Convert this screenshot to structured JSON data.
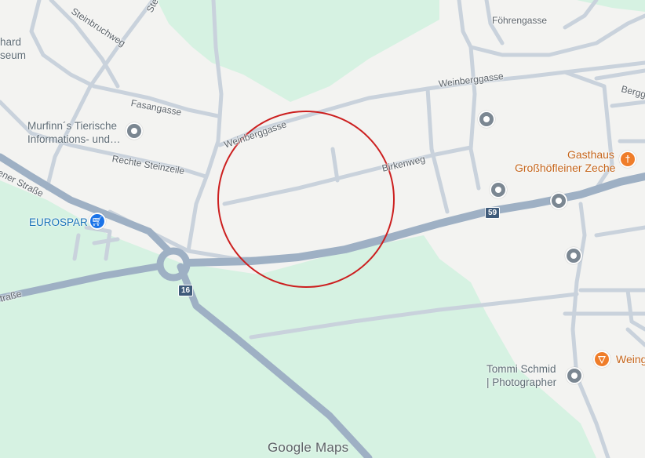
{
  "map": {
    "streets": {
      "steinbruchweg": "Steinbruchweg",
      "steinbruch_partial": "Stei",
      "fasangasse": "Fasangasse",
      "rechte_steinzeile": "Rechte Steinzeile",
      "weinberggasse_left": "Weinberggasse",
      "weinberggasse_right": "Weinberggasse",
      "birkenweg": "Birkenweg",
      "foehrengasse": "Föhrengasse",
      "bergg_partial": "Bergg",
      "strasse_left": "ener Straße",
      "strasse_bottom": "traße"
    },
    "places": {
      "museum_partial_1": "hard",
      "museum_partial_2": "seum",
      "murfinn_line1": "Murfinn´s Tierische",
      "murfinn_line2": "Informations- und…",
      "eurospar": "EUROSPAR",
      "gasthaus_line1": "Gasthaus",
      "gasthaus_line2": "Großhöfleiner Zeche",
      "tommi_line1": "Tommi Schmid",
      "tommi_line2": "| Photographer",
      "weing_partial": "Weing"
    },
    "shields": {
      "route_59": "59",
      "route_16": "16"
    },
    "icons": {
      "generic_pin": "place-pin-icon",
      "restaurant": "fork-knife-icon",
      "shopping": "shopping-cart-icon",
      "monument": "monument-icon",
      "museum": "museum-icon",
      "wine": "wine-glass-icon"
    },
    "colors": {
      "land": "#f3f3f1",
      "park": "#d6f2e2",
      "minor_road": "#c9d2dc",
      "main_road": "#9eb0c4",
      "circle": "#cc1f1f",
      "poi_grey": "#7b8792",
      "poi_orange": "#ef7d2a",
      "poi_blue": "#1a73e8"
    }
  },
  "brand": {
    "google": "Google",
    "maps": "Maps"
  }
}
